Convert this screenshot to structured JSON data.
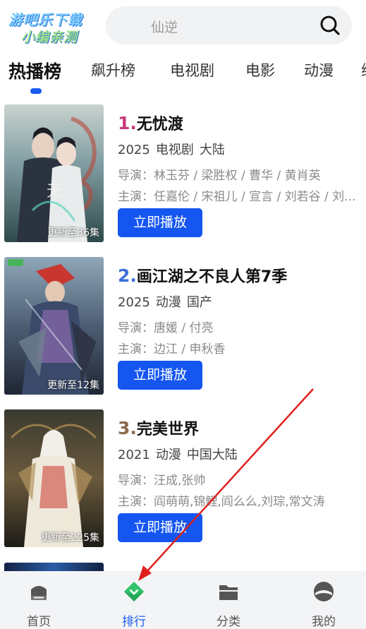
{
  "header": {
    "logo_line1": "游吧乐下载",
    "logo_line2": "小编亲测",
    "search_placeholder": "仙逆",
    "search_icon": "search-icon"
  },
  "tabs": [
    {
      "label": "热播榜",
      "active": true
    },
    {
      "label": "飙升榜",
      "active": false
    },
    {
      "label": "电视剧",
      "active": false
    },
    {
      "label": "电影",
      "active": false
    },
    {
      "label": "动漫",
      "active": false
    },
    {
      "label": "综",
      "active": false
    }
  ],
  "items": [
    {
      "rank": "1.",
      "title": "无忧渡",
      "year": "2025",
      "type": "电视剧",
      "region": "大陆",
      "director": "导演：林玉芬 / 梁胜权 / 曹华 / 黄肖英",
      "cast": "主演：任嘉伦 / 宋祖儿 / 宣言 / 刘若谷 / 刘...",
      "badge": "更新至36集",
      "play_label": "立即播放",
      "rank_color": "#c63a7a"
    },
    {
      "rank": "2.",
      "title": "画江湖之不良人第7季",
      "year": "2025",
      "type": "动漫",
      "region": "国产",
      "director": "导演：唐媛 / 付亮",
      "cast": "主演：边江 / 申秋香",
      "badge": "更新至12集",
      "play_label": "立即播放",
      "rank_color": "#3b6fd9"
    },
    {
      "rank": "3.",
      "title": "完美世界",
      "year": "2021",
      "type": "动漫",
      "region": "中国大陆",
      "director": "导演：汪成,张帅",
      "cast": "主演：阎萌萌,锦鲤,阎么么,刘琮,常文涛",
      "badge": "更新至225集",
      "play_label": "立即播放",
      "rank_color": "#8a6a4a"
    }
  ],
  "bottom_nav": [
    {
      "label": "首页",
      "icon": "home-icon",
      "active": false
    },
    {
      "label": "排行",
      "icon": "ranking-icon",
      "active": true
    },
    {
      "label": "分类",
      "icon": "category-folder-icon",
      "active": false
    },
    {
      "label": "我的",
      "icon": "profile-icon",
      "active": false
    }
  ],
  "colors": {
    "accent": "#1a5cf0",
    "play_button": "#1556f0",
    "nav_background": "#f3f4f6",
    "annotation_arrow": "#e0201e",
    "ranking_icon": "#2fc26a"
  }
}
